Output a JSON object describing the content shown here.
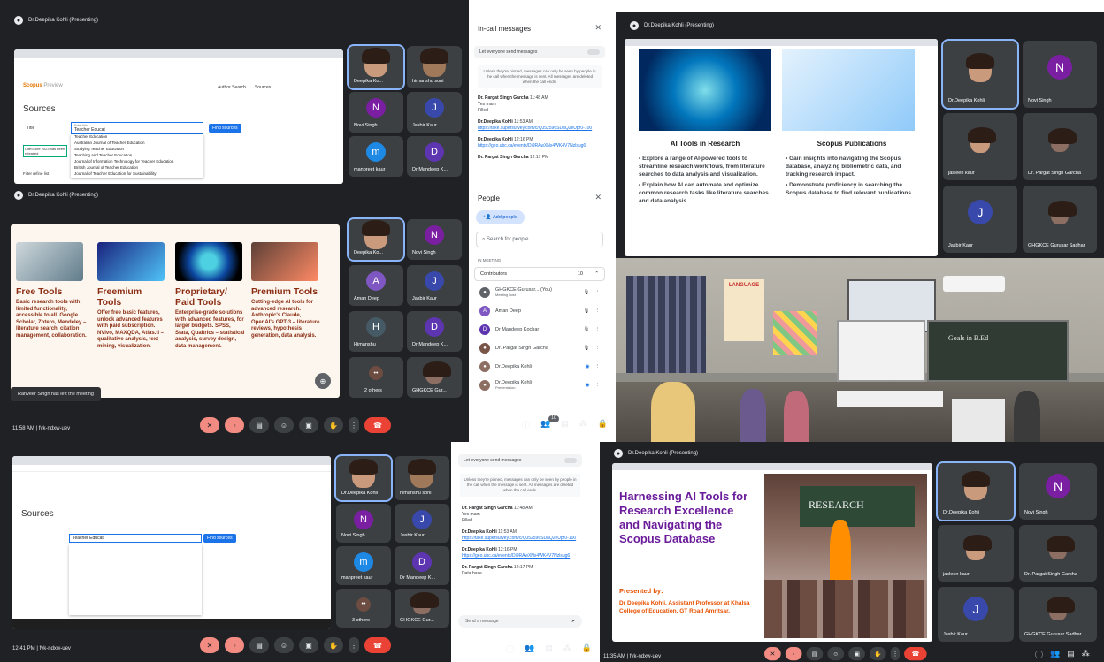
{
  "top_left": {
    "presenter": "Dr.Deepika Kohli (Presenting)",
    "scopus_brand": "Scopus",
    "scopus_preview": "Preview",
    "author_search": "Author Search",
    "sources_link": "Sources",
    "sources_heading": "Sources",
    "title_label": "Title",
    "enter_title": "Enter title",
    "search_value": "Teacher Educat",
    "find_sources": "Find sources",
    "filter_label": "Filter refine list",
    "citescore_note": "CiteScore 2023 has been released",
    "suggestions": [
      "Teacher Education",
      "Australian Journal of Teacher Education",
      "Studying Teacher Education",
      "Teaching and Teacher Education",
      "Journal of Information Technology for Teacher Education",
      "British Journal of Teacher Education",
      "Journal of Teacher Education for Sustainability"
    ],
    "participants": [
      {
        "name": "Deepika Ko...",
        "kind": "video"
      },
      {
        "name": "himanshu soni",
        "kind": "video"
      },
      {
        "name": "Novi Singh",
        "initial": "N",
        "color": "#7b1fa2"
      },
      {
        "name": "Jasbir Kaur",
        "initial": "J",
        "color": "#3949ab"
      },
      {
        "name": "manpreet kaur",
        "initial": "m",
        "color": "#1e88e5"
      },
      {
        "name": "Dr Mandeep K...",
        "initial": "D",
        "color": "#5e35b1"
      }
    ]
  },
  "mid_left": {
    "presenter": "Dr.Deepika Kohli (Presenting)",
    "cards": [
      {
        "title": "Free Tools",
        "body": "Basic research tools with limited functionality, accessible to all. Google Scholar, Zotero, Mendeley – literature search, citation management, collaboration."
      },
      {
        "title": "Freemium Tools",
        "body": "Offer free basic features, unlock advanced features with paid subscription. NVivo, MAXQDA, Atlas.ti – qualitative analysis, text mining, visualization."
      },
      {
        "title": "Proprietary/ Paid Tools",
        "body": "Enterprise-grade solutions with advanced features, for larger budgets. SPSS, Stata, Qualtrics – statistical analysis, survey design, data management."
      },
      {
        "title": "Premium Tools",
        "body": "Cutting-edge AI tools for advanced research. Anthropic's Claude, OpenAI's GPT-3 – literature reviews, hypothesis generation, data analysis."
      }
    ],
    "toast": "Ranveer Singh has left the meeting",
    "participants": [
      {
        "name": "Deepika Ko...",
        "kind": "video"
      },
      {
        "name": "Novi Singh",
        "initial": "N",
        "color": "#7b1fa2"
      },
      {
        "name": "Aman Deep",
        "initial": "A",
        "color": "#7e57c2"
      },
      {
        "name": "Jasbir Kaur",
        "initial": "J",
        "color": "#3949ab"
      },
      {
        "name": "Himanshu",
        "initial": "H",
        "color": "#455a64"
      },
      {
        "name": "Dr Mandeep K...",
        "initial": "D",
        "color": "#5e35b1"
      },
      {
        "name": "2 others",
        "kind": "others"
      },
      {
        "name": "GHGKCE Gur...",
        "kind": "video2"
      }
    ],
    "time": "11:58 AM | fvk-ndxw-uev"
  },
  "messages_panel": {
    "title": "In-call messages",
    "toggle_label": "Let everyone send messages",
    "notice": "Unless they're pinned, messages can only be seen by people in the call when the message is sent. All messages are deleted when the call ends.",
    "messages": [
      {
        "who": "Dr. Pargat Singh Garcha",
        "time": "11:48 AM",
        "lines": [
          "Yes mam",
          "Filled"
        ]
      },
      {
        "who": "Dr.Deepika Kohli",
        "time": "11:53 AM",
        "link": "https://take.supersurvey.com/c/QJ52596SDaQ2eUpr0-100"
      },
      {
        "who": "Dr.Deepika Kohli",
        "time": "12:16 PM",
        "link": "https://geo.ubc.ca/events/Di9RAwXNx4WK4V7Nzlsug6"
      },
      {
        "who": "Dr. Pargat Singh Garcha",
        "time": "12:17 PM",
        "lines": []
      }
    ]
  },
  "people_panel": {
    "title": "People",
    "add_people": "Add people",
    "search_placeholder": "Search for people",
    "in_meeting": "IN MEETING",
    "contributors_label": "Contributors",
    "contributors_count": "10",
    "people": [
      {
        "name": "GHGKCE Gurusar... (You)",
        "sub": "Meeting host",
        "color": "#5f6368"
      },
      {
        "name": "Aman Deep",
        "initial": "A",
        "color": "#7e57c2"
      },
      {
        "name": "Dr Mandeep Kochar",
        "initial": "D",
        "color": "#5e35b1"
      },
      {
        "name": "Dr. Pargat Singh Garcha",
        "color": "#795548"
      },
      {
        "name": "Dr.Deepika Kohli",
        "color": "#8d6e63"
      },
      {
        "name": "Dr.Deepika Kohli",
        "sub": "Presentation",
        "color": "#8d6e63"
      }
    ],
    "badge": "10"
  },
  "top_right": {
    "presenter": "Dr.Deepika Kohli (Presenting)",
    "col1_title": "AI Tools in Research",
    "col1_bullets": [
      "Explore a range of AI-powered tools to streamline research workflows, from literature searches to data analysis and visualization.",
      "Explain how AI can automate and optimize common research tasks like literature searches and data analysis."
    ],
    "col2_title": "Scopus Publications",
    "col2_bullets": [
      "Gain insights into navigating the Scopus database, analyzing bibliometric data, and tracking research impact.",
      "Demonstrate proficiency in searching the Scopus database to find relevant publications."
    ],
    "participants": [
      {
        "name": "Dr.Deepika Kohli",
        "kind": "video"
      },
      {
        "name": "Novi Singh",
        "initial": "N",
        "color": "#7b1fa2"
      },
      {
        "name": "jasleen kaur",
        "kind": "video"
      },
      {
        "name": "Dr. Pargat Singh Garcha",
        "kind": "video2"
      },
      {
        "name": "Jasbir Kaur",
        "initial": "J",
        "color": "#3949ab"
      },
      {
        "name": "GHGKCE Gurusar Sadhar",
        "kind": "video2"
      }
    ]
  },
  "photo": {
    "poster": "LANGUAGE",
    "board_text": "Goals in B.Ed"
  },
  "bottom_left": {
    "search_value": "Teacher Educat",
    "sources_heading": "Sources",
    "find_sources": "Find sources",
    "participants": [
      {
        "name": "Dr.Deepika Kohli",
        "kind": "video"
      },
      {
        "name": "himanshu soni",
        "kind": "video"
      },
      {
        "name": "Novi Singh",
        "initial": "N",
        "color": "#7b1fa2"
      },
      {
        "name": "Jasbir Kaur",
        "initial": "J",
        "color": "#3949ab"
      },
      {
        "name": "manpreet kaur",
        "initial": "m",
        "color": "#1e88e5"
      },
      {
        "name": "Dr Mandeep K...",
        "initial": "D",
        "color": "#5e35b1"
      },
      {
        "name": "3 others",
        "kind": "others"
      },
      {
        "name": "GHGKCE Gur...",
        "kind": "video2"
      }
    ],
    "time": "12:41 PM | fvk-ndxw-uev",
    "messages_toggle": "Let everyone send messages",
    "messages": [
      {
        "who": "Dr. Pargat Singh Garcha",
        "time": "11:48 AM",
        "lines": [
          "Yes mam",
          "Filled"
        ]
      },
      {
        "who": "Dr.Deepika Kohli",
        "time": "11:53 AM",
        "link": "https://take.supersurvey.com/c/QJ52596SDaQ2eUpr0-100"
      },
      {
        "who": "Dr.Deepika Kohli",
        "time": "12:16 PM",
        "link": "https://geo.ubc.ca/events/Di9RAwXNx4WK4V7Nzlsug6"
      },
      {
        "who": "Dr. Pargat Singh Garcha",
        "time": "12:17 PM",
        "lines": [
          "Data base"
        ]
      }
    ],
    "send_placeholder": "Send a message"
  },
  "bottom_right": {
    "presenter": "Dr.Deepika Kohli (Presenting)",
    "slide_title": "Harnessing AI Tools for Research Excellence and Navigating the Scopus Database",
    "presented_by": "Presented by:",
    "presenter_credit": "Dr Deepika Kohli, Assistant Professor at Khalsa College of Education, GT Road Amritsar.",
    "board_word": "RESEARCH",
    "participants": [
      {
        "name": "Dr.Deepika Kohli",
        "kind": "video"
      },
      {
        "name": "Novi Singh",
        "initial": "N",
        "color": "#7b1fa2"
      },
      {
        "name": "jasleen kaur",
        "kind": "video"
      },
      {
        "name": "Dr. Pargat Singh Garcha",
        "kind": "video2"
      },
      {
        "name": "Jasbir Kaur",
        "initial": "J",
        "color": "#3949ab"
      },
      {
        "name": "GHGKCE Gurusar Sadhar",
        "kind": "video2"
      }
    ],
    "time": "11:35 AM | fvk-ndxw-uev"
  },
  "colors": {
    "meet_bg": "#202124",
    "tile_bg": "#3c4043",
    "end_call": "#ea4335",
    "slide_brown": "#8b2e14",
    "slide_purple": "#6a1b9a"
  }
}
